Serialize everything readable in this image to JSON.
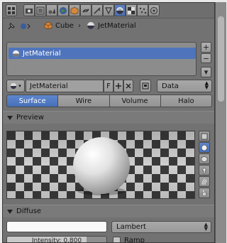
{
  "toolbar": {
    "icons": [
      "render-icon",
      "render-layers-icon",
      "scene-icon",
      "world-icon",
      "object-icon",
      "constraints-icon",
      "modifiers-icon",
      "data-icon",
      "material-icon",
      "texture-icon",
      "particles-icon",
      "physics-icon"
    ],
    "active": "material-icon"
  },
  "breadcrumb": {
    "object": "Cube",
    "material": "JetMaterial"
  },
  "material_slots": {
    "items": [
      {
        "label": "JetMaterial"
      }
    ],
    "buttons": [
      "+",
      "−",
      "▾"
    ]
  },
  "datablock": {
    "name": "JetMaterial",
    "fake_user": "F",
    "mode": "Data"
  },
  "tabs": [
    {
      "label": "Surface",
      "active": true
    },
    {
      "label": "Wire",
      "active": false
    },
    {
      "label": "Volume",
      "active": false
    },
    {
      "label": "Halo",
      "active": false
    }
  ],
  "preview": {
    "title": "Preview",
    "shapes": [
      "plane-icon",
      "sphere-icon",
      "cube-icon",
      "monkey-icon",
      "hair-icon",
      "sky-icon"
    ],
    "active": "sphere-icon"
  },
  "diffuse": {
    "title": "Diffuse",
    "color": "#fafafa",
    "shader": "Lambert",
    "intensity_label": "Intensity: 0.800",
    "intensity_value": 0.8,
    "ramp_label": "Ramp"
  },
  "colors": {
    "accent": "#4f74bc",
    "panel": "#727272"
  }
}
